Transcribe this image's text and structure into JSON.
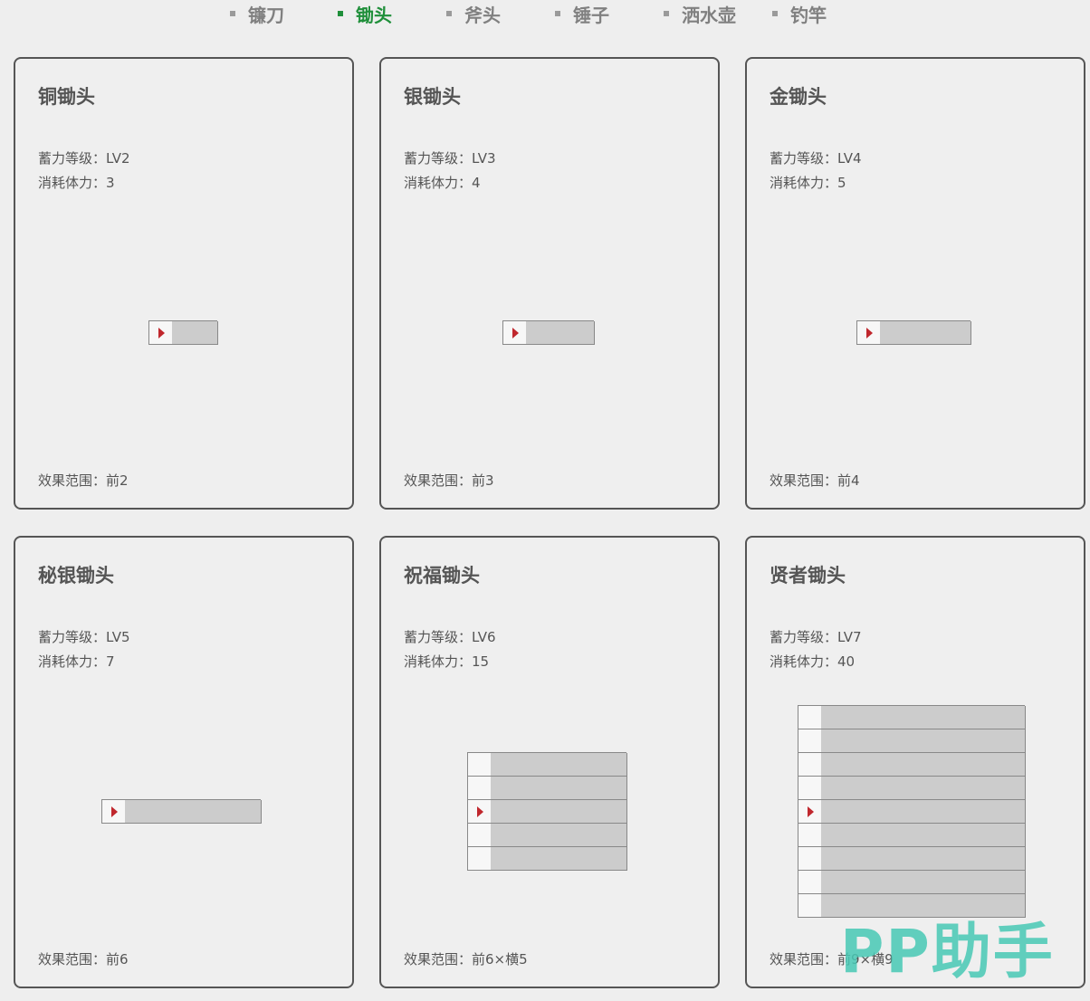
{
  "tabs": [
    {
      "label": "镰刀",
      "active": false
    },
    {
      "label": "锄头",
      "active": true
    },
    {
      "label": "斧头",
      "active": false
    },
    {
      "label": "锤子",
      "active": false
    },
    {
      "label": "洒水壶",
      "active": false
    },
    {
      "label": "钓竿",
      "active": false
    }
  ],
  "colors": {
    "active_tab": "#1f8f3a",
    "inactive_tab": "#808080",
    "player_marker": "#c0272d",
    "affected_cell": "#cccccc",
    "empty_cell": "#f7f7f7"
  },
  "cards": [
    {
      "title": "铜锄头",
      "level": "蓄力等级：LV2",
      "stamina": "消耗体力：3",
      "range": "效果范围：前2",
      "effect": {
        "forward": 2,
        "width": 1
      }
    },
    {
      "title": "银锄头",
      "level": "蓄力等级：LV3",
      "stamina": "消耗体力：4",
      "range": "效果范围：前3",
      "effect": {
        "forward": 3,
        "width": 1
      }
    },
    {
      "title": "金锄头",
      "level": "蓄力等级：LV4",
      "stamina": "消耗体力：5",
      "range": "效果范围：前4",
      "effect": {
        "forward": 4,
        "width": 1
      }
    },
    {
      "title": "秘银锄头",
      "level": "蓄力等级：LV5",
      "stamina": "消耗体力：7",
      "range": "效果范围：前6",
      "effect": {
        "forward": 6,
        "width": 1
      }
    },
    {
      "title": "祝福锄头",
      "level": "蓄力等级：LV6",
      "stamina": "消耗体力：15",
      "range": "效果范围：前6×横5",
      "effect": {
        "forward": 6,
        "width": 5
      }
    },
    {
      "title": "贤者锄头",
      "level": "蓄力等级：LV7",
      "stamina": "消耗体力：40",
      "range": "效果范围：前9×横9",
      "effect": {
        "forward": 9,
        "width": 9
      }
    }
  ],
  "watermark": {
    "text": "PP助手"
  }
}
